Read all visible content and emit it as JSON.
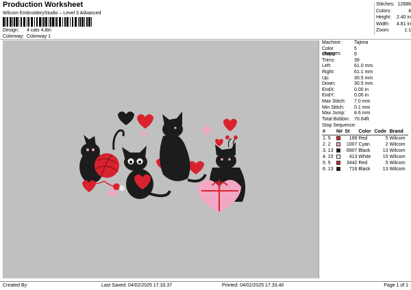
{
  "header": {
    "title": "Production Worksheet",
    "subtitle": "Wilcom EmbroideryStudio – Level 3 Advanced",
    "design_label": "Design:",
    "design_value": "4 cats 4,8in",
    "colorway_label": "Colorway:",
    "colorway_value": "Colorway 1"
  },
  "stats": [
    {
      "k": "Stitches:",
      "v": "12686"
    },
    {
      "k": "Colors:",
      "v": "4"
    },
    {
      "k": "Height:",
      "v": "2.40 in"
    },
    {
      "k": "Width:",
      "v": "4.81 in"
    },
    {
      "k": "Zoom:",
      "v": "1:1"
    }
  ],
  "machine_info": [
    {
      "k": "Machine:",
      "v": "Tajima"
    },
    {
      "k": "Color changes:",
      "v": "5"
    },
    {
      "k": "Stops:",
      "v": "6"
    },
    {
      "k": "Trims:",
      "v": "39"
    },
    {
      "k": "Left:",
      "v": "61.0 mm"
    },
    {
      "k": "Right:",
      "v": "61.1 mm"
    },
    {
      "k": "Up:",
      "v": "30.5 mm"
    },
    {
      "k": "Down:",
      "v": "30.5 mm"
    },
    {
      "k": "EndX:",
      "v": "0.00 in"
    },
    {
      "k": "EndY:",
      "v": "0.00 in"
    },
    {
      "k": "Max Stitch:",
      "v": "7.0 mm"
    },
    {
      "k": "Min Stitch:",
      "v": "0.1 mm"
    },
    {
      "k": "Max Jump:",
      "v": "8.6 mm"
    },
    {
      "k": "Total Bobbin:",
      "v": "70.64ft"
    }
  ],
  "stop_sequence": {
    "heading": "Stop Sequence:",
    "columns": [
      "#",
      "N#",
      "St",
      "Color",
      "Code",
      "Brand"
    ],
    "rows": [
      {
        "n": "1.",
        "nn": "5",
        "st": "199",
        "color": "Red",
        "code": "5",
        "brand": "Wilcom",
        "hex": "#d8232f"
      },
      {
        "n": "2.",
        "nn": "2",
        "st": "1007",
        "color": "Cyan",
        "code": "2",
        "brand": "Wilcom",
        "hex": "#f2a7c4"
      },
      {
        "n": "3.",
        "nn": "13",
        "st": "6907",
        "color": "Black",
        "code": "13",
        "brand": "Wilcom",
        "hex": "#1c1c1c"
      },
      {
        "n": "4.",
        "nn": "15",
        "st": "413",
        "color": "White",
        "code": "15",
        "brand": "Wilcom",
        "hex": "#ffffff"
      },
      {
        "n": "5.",
        "nn": "5",
        "st": "3442",
        "color": "Red",
        "code": "5",
        "brand": "Wilcom",
        "hex": "#d8232f"
      },
      {
        "n": "6.",
        "nn": "13",
        "st": "716",
        "color": "Black",
        "code": "13",
        "brand": "Wilcom",
        "hex": "#1c1c1c"
      }
    ]
  },
  "footer": {
    "created_by": "Created By:",
    "last_saved": "Last Saved: 04/02/2025 17.33.37",
    "printed": "Printed: 04/02/2025 17.33.40",
    "page": "Page 1 of 1"
  },
  "colors": {
    "red": "#d8232f",
    "pink": "#f2a7c4",
    "black": "#1c1c1c",
    "canvas": "#c0c0c0"
  }
}
